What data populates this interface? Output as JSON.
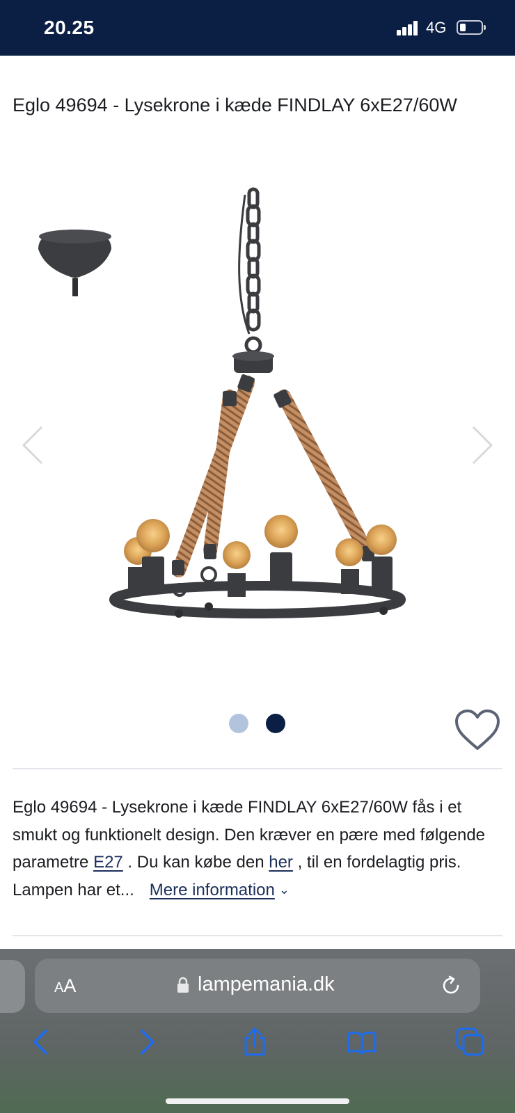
{
  "status_bar": {
    "time": "20.25",
    "network": "4G",
    "icons": [
      "signal-icon",
      "battery-icon"
    ]
  },
  "product": {
    "title": "Eglo 49694 - Lysekrone i kæde FINDLAY 6xE27/60W"
  },
  "gallery": {
    "image_count": 2,
    "active_index": 2,
    "icons": [
      "chevron-left-icon",
      "chevron-right-icon",
      "heart-icon"
    ]
  },
  "description": {
    "text_1": "Eglo 49694 - Lysekrone i kæde FINDLAY 6xE27/60W fås i et smukt og funktionelt design. Den kræver en pære med følgende parametre ",
    "link_e27": "E27",
    "text_2": " . Du kan købe den ",
    "link_her": "her",
    "text_3": " , til en fordelagtig pris. Lampen har et...",
    "more_label": "Mere information"
  },
  "browser": {
    "text_size_label_small": "A",
    "text_size_label_big": "A",
    "domain": "lampemania.dk",
    "icons": [
      "lock-icon",
      "reload-icon",
      "back-icon",
      "forward-icon",
      "share-icon",
      "bookmarks-icon",
      "tabs-icon"
    ]
  },
  "colors": {
    "navy": "#0b1f45",
    "dot_inactive": "#b2c4dd",
    "link": "#1b2f5b"
  }
}
